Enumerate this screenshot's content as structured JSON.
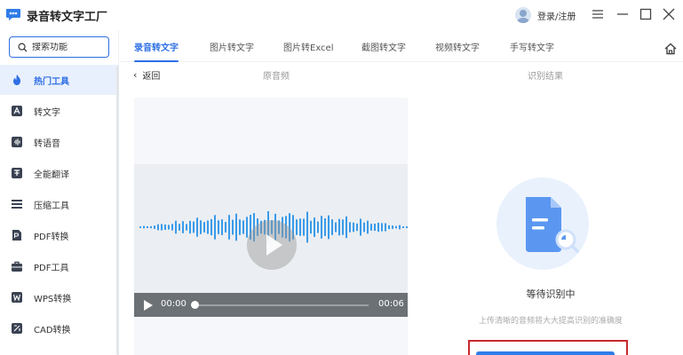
{
  "app": {
    "title": "录音转文字工厂",
    "login_label": "登录/注册"
  },
  "window_controls": [
    "menu-icon",
    "minimize-icon",
    "maximize-icon",
    "close-icon"
  ],
  "search": {
    "placeholder": "搜索功能"
  },
  "sidebar": {
    "items": [
      {
        "label": "热门工具",
        "icon": "flame-icon",
        "active": true
      },
      {
        "label": "转文字",
        "icon": "text-icon",
        "active": false
      },
      {
        "label": "转语音",
        "icon": "voice-icon",
        "active": false
      },
      {
        "label": "全能翻译",
        "icon": "translate-icon",
        "active": false
      },
      {
        "label": "压缩工具",
        "icon": "compress-icon",
        "active": false
      },
      {
        "label": "PDF转换",
        "icon": "pdf-convert-icon",
        "active": false
      },
      {
        "label": "PDF工具",
        "icon": "pdf-tool-icon",
        "active": false
      },
      {
        "label": "WPS转换",
        "icon": "wps-icon",
        "active": false
      },
      {
        "label": "CAD转换",
        "icon": "cad-icon",
        "active": false
      }
    ]
  },
  "tabs": [
    {
      "label": "录音转文字",
      "active": true
    },
    {
      "label": "图片转文字",
      "active": false
    },
    {
      "label": "图片转Excel",
      "active": false
    },
    {
      "label": "截图转文字",
      "active": false
    },
    {
      "label": "视频转文字",
      "active": false
    },
    {
      "label": "手写转文字",
      "active": false
    }
  ],
  "subheader": {
    "back_label": "返回",
    "left_column": "原音频",
    "right_column": "识别结果"
  },
  "player": {
    "current_time": "00:00",
    "total_time": "00:06",
    "progress": 0
  },
  "result": {
    "status_title": "等待识别中",
    "hint": "上传清晰的音频将大大提高识别的准确度"
  },
  "colors": {
    "accent": "#2f6fe4",
    "active_bg": "#e8f0fd",
    "highlight_border": "#c8292f"
  }
}
